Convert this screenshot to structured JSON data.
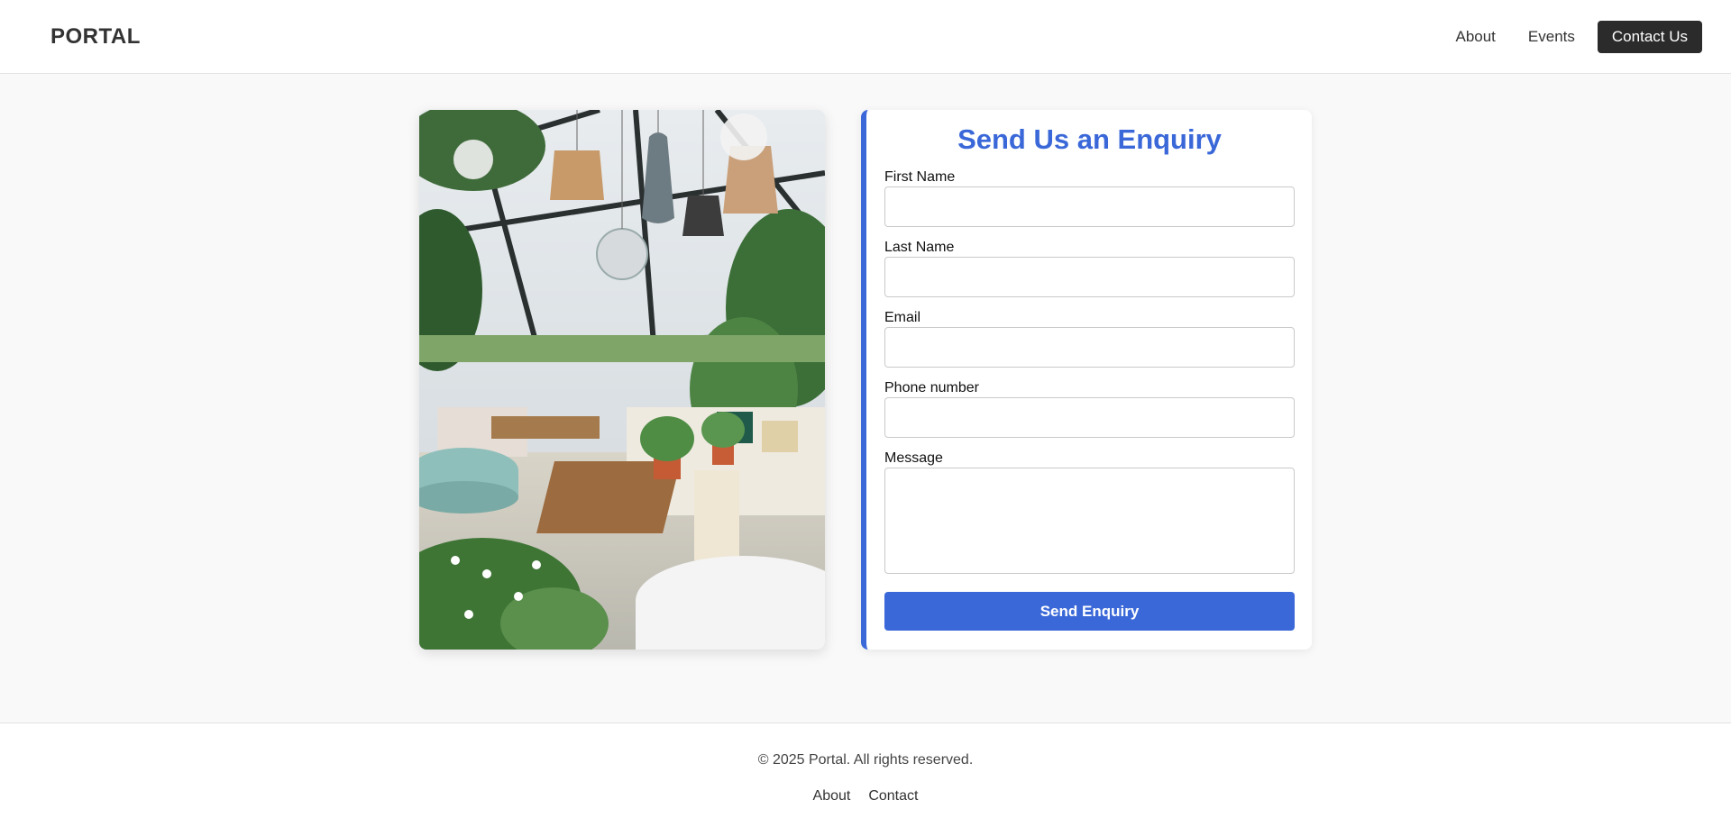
{
  "header": {
    "brand": "PORTAL",
    "nav": {
      "about": "About",
      "events": "Events",
      "contact": "Contact Us"
    }
  },
  "hero_image": {
    "icon": "venue-interior-photo"
  },
  "form": {
    "title": "Send Us an Enquiry",
    "fields": {
      "first_name": {
        "label": "First Name",
        "value": ""
      },
      "last_name": {
        "label": "Last Name",
        "value": ""
      },
      "email": {
        "label": "Email",
        "value": ""
      },
      "phone": {
        "label": "Phone number",
        "value": ""
      },
      "message": {
        "label": "Message",
        "value": ""
      }
    },
    "submit_label": "Send Enquiry"
  },
  "footer": {
    "copyright": "© 2025 Portal. All rights reserved.",
    "links": {
      "about": "About",
      "contact": "Contact"
    }
  },
  "colors": {
    "accent": "#3a68d8",
    "cta_dark": "#2b2b2b",
    "page_bg": "#f9f9f9"
  }
}
